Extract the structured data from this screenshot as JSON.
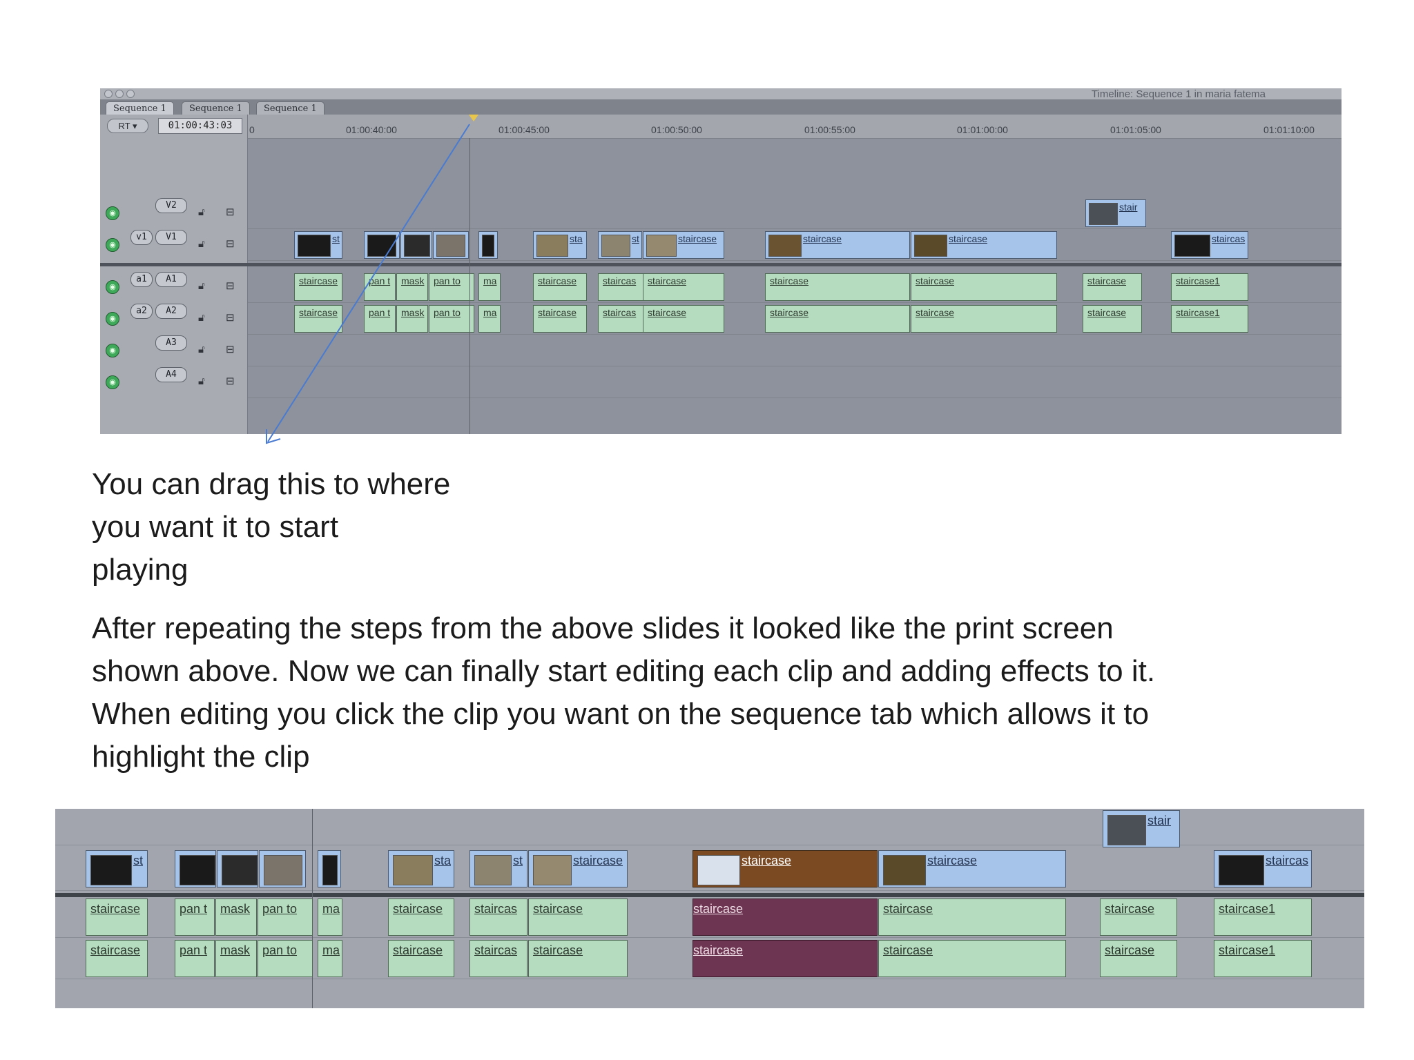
{
  "window": {
    "title": "Timeline: Sequence 1 in maria fatema",
    "tabs": [
      "Sequence 1",
      "Sequence 1",
      "Sequence 1"
    ],
    "rt_button": "RT",
    "timecode": "01:00:43:03",
    "ruler_ticks": [
      "0",
      "01:00:40:00",
      "01:00:45:00",
      "01:00:50:00",
      "01:00:55:00",
      "01:01:00:00",
      "01:01:05:00",
      "01:01:10:00"
    ],
    "tracks": {
      "v2": {
        "target": "",
        "label": "V2"
      },
      "v1": {
        "target": "v1",
        "label": "V1"
      },
      "a1": {
        "target": "a1",
        "label": "A1"
      },
      "a2": {
        "target": "a2",
        "label": "A2"
      },
      "a3": {
        "target": "",
        "label": "A3"
      },
      "a4": {
        "target": "",
        "label": "A4"
      }
    },
    "video_clips_v2": [
      "stair"
    ],
    "video_clips_v1": [
      "st",
      "",
      "",
      "",
      "sta",
      "st",
      "staircase",
      "staircase",
      "staircase",
      "staircas"
    ],
    "audio_clips": [
      "staircase",
      "pan t",
      "mask",
      "pan to",
      "ma",
      "staircase",
      "staircas",
      "staircase",
      "staircase",
      "staircase",
      "staircase",
      "staircase1"
    ]
  },
  "annotation": {
    "drag_text_lines": [
      "You can drag this to where",
      "you want it to start",
      "playing"
    ],
    "paragraph_lines": [
      "After repeating the steps from the above slides it looked like the  print screen",
      "shown above. Now we can finally start editing each clip and adding effects to it.",
      "When editing you click the clip you want on the sequence tab which allows it to",
      "highlight the clip"
    ]
  },
  "zoomed": {
    "video_clips_v2": [
      "stair"
    ],
    "video_clips_v1": [
      "st",
      "",
      "",
      "",
      "sta",
      "st",
      "staircase",
      "staircase",
      "staircase",
      "staircas"
    ],
    "audio_clips": [
      "staircase",
      "pan t",
      "mask",
      "pan to",
      "ma",
      "staircase",
      "staircas",
      "staircase",
      "staircase",
      "staircase",
      "staircase",
      "staircase1"
    ],
    "selected_clip_label": "staircase"
  },
  "colors": {
    "video_clip": "#a6c4ea",
    "audio_clip": "#b6dcbf",
    "selected_video": "#7b4a22",
    "selected_audio": "#6d3551",
    "arrow": "#4a7bd0"
  }
}
